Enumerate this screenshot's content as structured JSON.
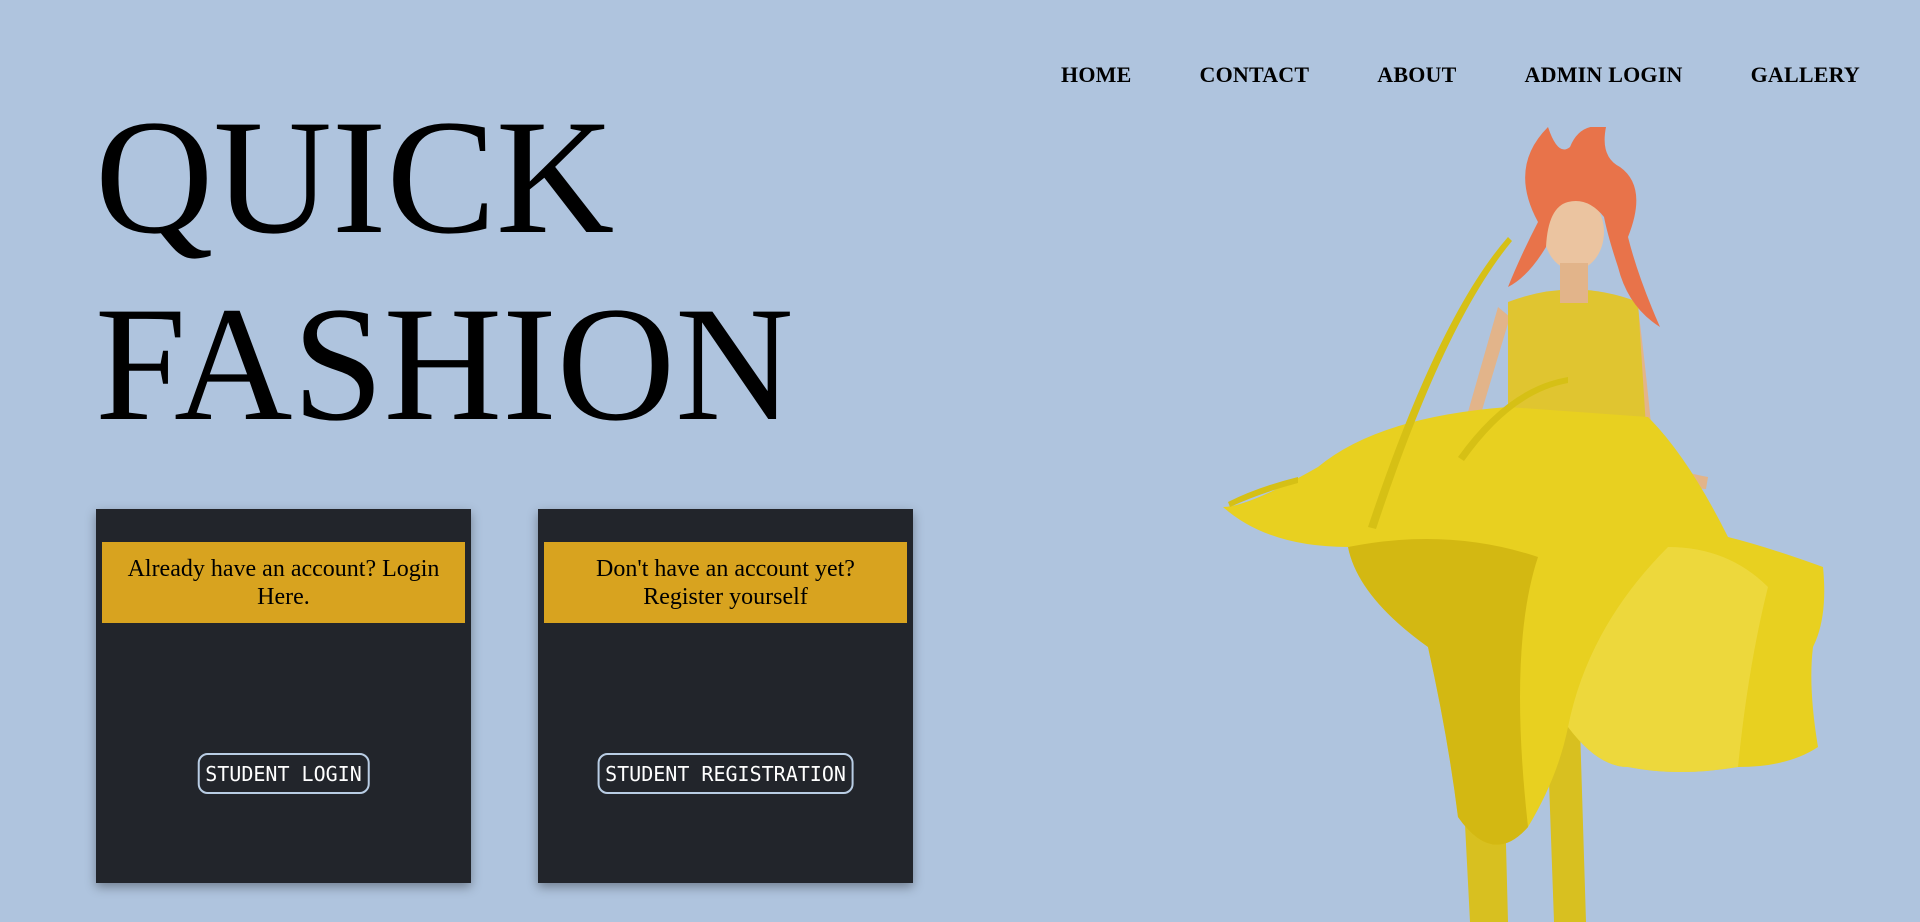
{
  "nav": {
    "items": [
      {
        "label": "HOME"
      },
      {
        "label": "CONTACT"
      },
      {
        "label": "ABOUT"
      },
      {
        "label": "ADMIN LOGIN"
      },
      {
        "label": "GALLERY"
      }
    ]
  },
  "hero": {
    "title_line1": "QUICK",
    "title_line2": "FASHION",
    "image": "fashion-model-yellow-dress"
  },
  "cards": {
    "login": {
      "caption": "Already have an account? Login Here.",
      "button_label": "STUDENT LOGIN"
    },
    "register": {
      "caption": "Don't have an account yet? Register yourself",
      "button_label": "STUDENT REGISTRATION"
    }
  },
  "colors": {
    "background": "#afc4de",
    "card": "#22252b",
    "caption": "#d8a31f",
    "button_border": "#b9cde4",
    "dress": "#e8d020",
    "hair": "#e8734a"
  }
}
